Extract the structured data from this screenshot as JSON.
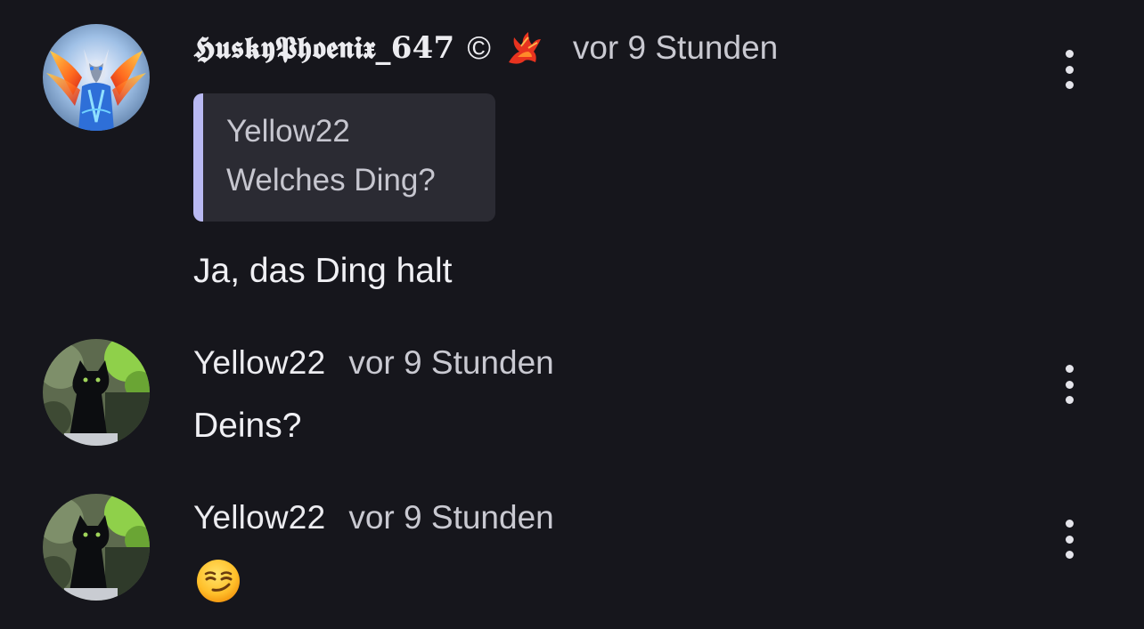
{
  "comments": [
    {
      "username": "𝕳𝖚𝖘𝖐𝖞𝕻𝖍𝖔𝖊𝖓𝖎𝖝_647",
      "copyright": "©",
      "badge_icon": "phoenix-emoji-icon",
      "time": "vor 9 Stunden",
      "avatar": "husky-phoenix-avatar",
      "quote": {
        "author": "Yellow22",
        "text": "Welches Ding?"
      },
      "text": "Ja, das Ding halt"
    },
    {
      "username": "Yellow22",
      "time": "vor 9 Stunden",
      "avatar": "black-cat-avatar",
      "text": "Deins?"
    },
    {
      "username": "Yellow22",
      "time": "vor 9 Stunden",
      "avatar": "black-cat-avatar",
      "emoji": "smirking-face-emoji"
    }
  ],
  "colors": {
    "background": "#16161c",
    "quote_background": "#2b2b33",
    "quote_accent": "#b9b9f2",
    "primary_text": "#ececf0",
    "secondary_text": "#c9c9d1"
  }
}
